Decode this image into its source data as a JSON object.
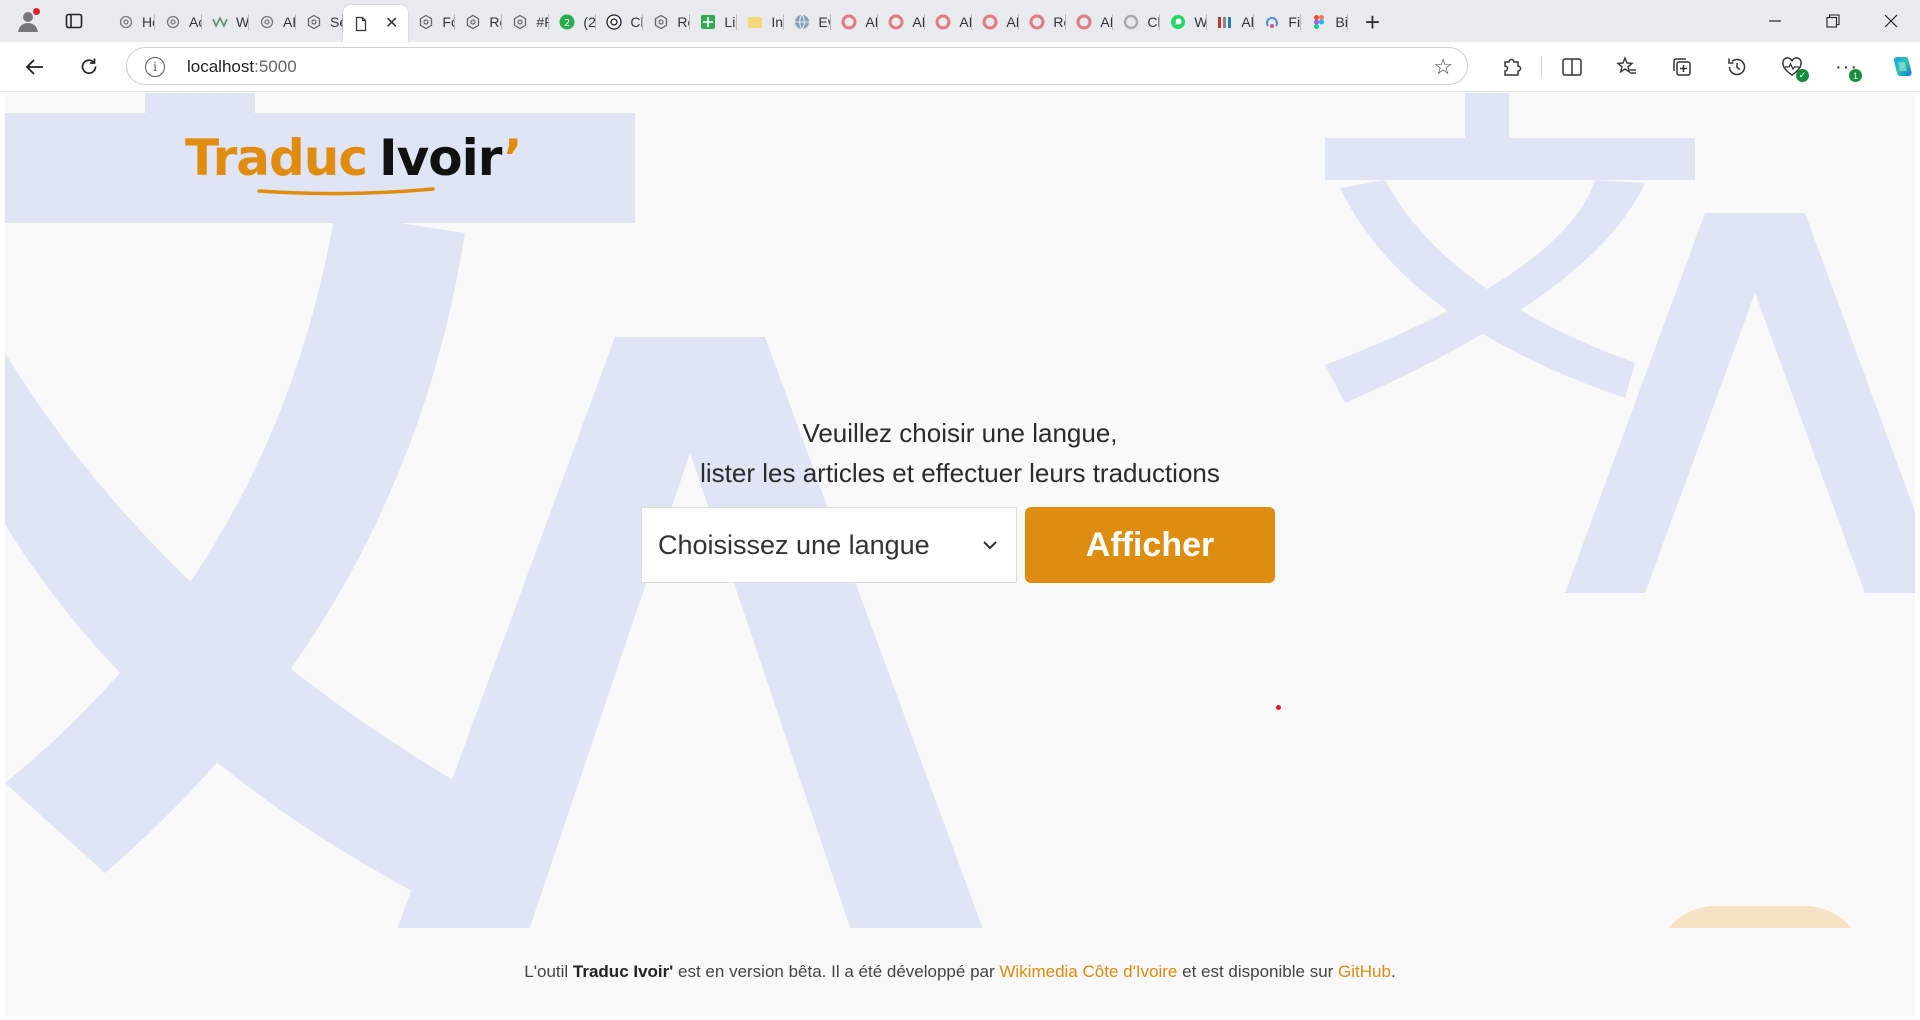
{
  "browser": {
    "tabs": [
      {
        "label": "Hc",
        "icon": "gear-outline-icon"
      },
      {
        "label": "Ac",
        "icon": "gear-outline-icon"
      },
      {
        "label": "Wi",
        "icon": "wiki-icon"
      },
      {
        "label": "AP",
        "icon": "gear-outline-icon"
      },
      {
        "label": "Se",
        "icon": "openai-icon"
      },
      {
        "label": "",
        "icon": "document-icon",
        "active": true
      },
      {
        "label": "Fo",
        "icon": "openai-icon"
      },
      {
        "label": "Re",
        "icon": "openai-icon"
      },
      {
        "label": "#F",
        "icon": "openai-icon"
      },
      {
        "label": "(2)",
        "icon": "green-badge-icon"
      },
      {
        "label": "Ch",
        "icon": "chatgpt-icon"
      },
      {
        "label": "Re",
        "icon": "openai-icon"
      },
      {
        "label": "Lis",
        "icon": "sheets-icon"
      },
      {
        "label": "Ini",
        "icon": "folder-icon"
      },
      {
        "label": "Ev",
        "icon": "globe-icon"
      },
      {
        "label": "AP",
        "icon": "pink-circle-icon"
      },
      {
        "label": "AP",
        "icon": "pink-circle-icon"
      },
      {
        "label": "AP",
        "icon": "pink-circle-icon"
      },
      {
        "label": "AP",
        "icon": "pink-circle-icon"
      },
      {
        "label": "Ré",
        "icon": "pink-circle-icon"
      },
      {
        "label": "AP",
        "icon": "pink-circle-icon"
      },
      {
        "label": "Ch",
        "icon": "gray-circle-icon"
      },
      {
        "label": "W",
        "icon": "whatsapp-icon"
      },
      {
        "label": "Ak",
        "icon": "bars-icon"
      },
      {
        "label": "Fil",
        "icon": "recycle-icon"
      },
      {
        "label": "Bi",
        "icon": "figma-icon"
      }
    ],
    "url_host": "localhost",
    "url_port": ":5000"
  },
  "page": {
    "logo_part1": "Traduc",
    "logo_part2": "Ivoir",
    "logo_apostrophe": "’",
    "heading_line1": "Veuillez choisir une langue,",
    "heading_line2": "lister les articles et effectuer leurs traductions",
    "select_placeholder": "Choisissez une langue",
    "submit_label": "Afficher",
    "footer": {
      "t1": "L'outil ",
      "product": "Traduc Ivoir'",
      "t2": " est en version bêta. Il a été développé par ",
      "org": "Wikimedia Côte d'Ivoire",
      "t3": " et est disponible sur ",
      "github": "GitHub",
      "t4": "."
    }
  },
  "colors": {
    "accent": "#de8d11",
    "background_glyph": "#dfe5f4",
    "page_bg": "#f9f9fa"
  }
}
